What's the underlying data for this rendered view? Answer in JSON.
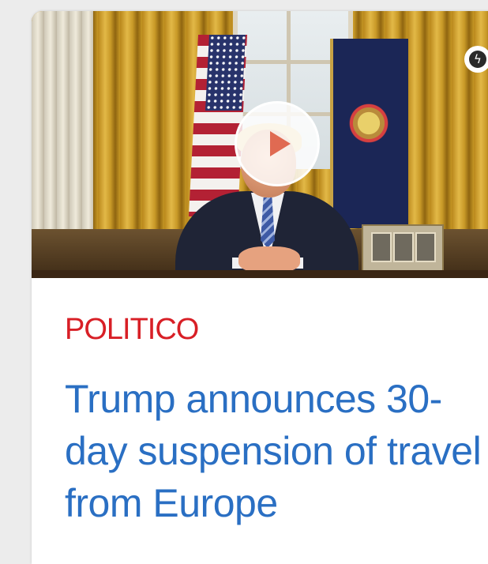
{
  "article": {
    "source": "POLITICO",
    "headline": "Trump announces 30-day suspension of travel from Europe",
    "has_video": true
  },
  "icons": {
    "play": "play-icon",
    "amp": "lightning-bolt-icon"
  },
  "colors": {
    "source_red": "#d81f26",
    "headline_blue": "#2a6fc3",
    "card_background": "#ffffff"
  }
}
